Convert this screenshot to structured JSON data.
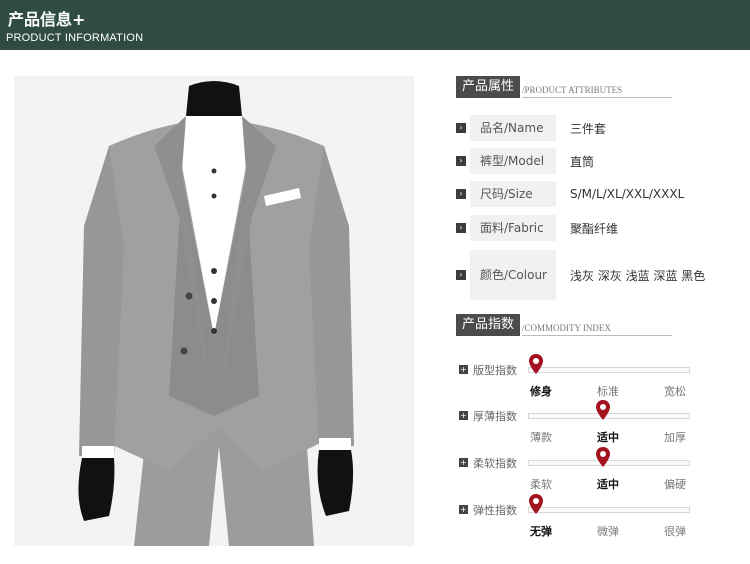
{
  "banner": {
    "title": "产品信息+",
    "subtitle": "PRODUCT INFORMATION"
  },
  "attributes": {
    "section_cn": "产品属性",
    "section_en": "/PRODUCT ATTRIBUTES",
    "rows": [
      {
        "label": "品名/Name",
        "value": "三件套"
      },
      {
        "label": "裤型/Model",
        "value": "直筒"
      },
      {
        "label": "尺码/Size",
        "value": "S/M/L/XL/XXL/XXXL"
      },
      {
        "label": "面料/Fabric",
        "value": "聚酯纤维"
      },
      {
        "label": "颜色/Colour",
        "value": "浅灰 深灰  浅蓝 深蓝 黑色"
      }
    ]
  },
  "index": {
    "section_cn": "产品指数",
    "section_en": "/COMMODITY INDEX",
    "rows": [
      {
        "label": "版型指数",
        "stops": [
          "修身",
          "标准",
          "宽松"
        ],
        "selected": 0
      },
      {
        "label": "厚薄指数",
        "stops": [
          "薄款",
          "适中",
          "加厚"
        ],
        "selected": 1
      },
      {
        "label": "柔软指数",
        "stops": [
          "柔软",
          "适中",
          "偏硬"
        ],
        "selected": 1
      },
      {
        "label": "弹性指数",
        "stops": [
          "无弹",
          "微弹",
          "很弹"
        ],
        "selected": 0
      }
    ]
  },
  "colors": {
    "banner": "#2f4b44",
    "pin": "#a3121f",
    "suit": "#9a9a9a"
  },
  "icons": {
    "arrow": "chevron-right-icon",
    "plus": "plus-icon",
    "pin": "map-pin-icon"
  }
}
